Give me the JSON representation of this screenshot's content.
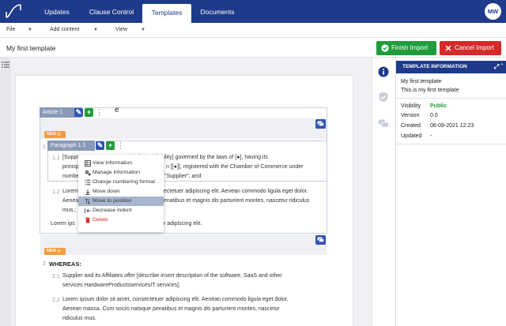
{
  "nav": {
    "tabs": [
      {
        "label": "Updates"
      },
      {
        "label": "Clause Control"
      },
      {
        "label": "Templates",
        "active": true
      },
      {
        "label": "Documents"
      }
    ],
    "avatar": "MW",
    "color": "#1e3a8a"
  },
  "menubar": {
    "file": "File",
    "add_content": "Add content",
    "view": "View"
  },
  "title": "My first template",
  "actions": {
    "finish": "Finish Import",
    "cancel": "Cancel Import",
    "finish_color": "#1f9d3a",
    "cancel_color": "#d42a2a"
  },
  "document": {
    "article_label": "Article 1",
    "article_title_tail": "e",
    "nda_tag": "NDA",
    "clause_num": "1",
    "paragraph_label": "Paragraph 1.1",
    "p11_num": "1.1",
    "p11_lines": [
      "[Suppl",
      "with limited liability] governed by the laws of [●], having its",
      "princip",
      "n [[●]], registered with the Chamber of Commerce under",
      "numbe",
      "\"Supplier\"; and"
    ],
    "p12_num": "1.2",
    "p12_lines": [
      "Lorem",
      "ectetuer adipiscing elit. Aenean commodo ligula eget dolor.",
      "Aenea",
      "enatibus et magnis dis parturient montes, nascetur ridiculus",
      "mus.;"
    ],
    "lorem_short_a": "Lorem ips",
    "lorem_short_b": "r adipiscing elit.",
    "whereas_num": "2",
    "whereas": "WHEREAS:",
    "p21_num": "2.1",
    "p21_lines": [
      "Supplier and its Affiliates offer [describe insert description of the software, SaaS and other",
      "services HardwareProductsservicesIT services]."
    ],
    "p22_num": "2.2",
    "p22_lines": [
      "Lorem ipsum dolor sit amet, consectetuer adipiscing elit. Aenean commodo ligula eget dolor.",
      "Aenean massa. Cum sociis natoque penatibus et magnis dis parturient montes, nascetur",
      "ridiculus mus."
    ]
  },
  "context_menu": {
    "items": [
      {
        "label": "View information",
        "icon": "table-icon"
      },
      {
        "label": "Manage information",
        "icon": "cogs-icon"
      },
      {
        "label": "Change numbering format",
        "icon": "list-icon"
      },
      {
        "label": "Move down",
        "icon": "arrow-down-icon"
      },
      {
        "label": "Move to position",
        "icon": "sort-icon",
        "highlighted": true
      },
      {
        "label": "Decrease indent",
        "icon": "outdent-icon"
      },
      {
        "label": "Delete",
        "icon": "trash-icon",
        "danger": true
      }
    ]
  },
  "panel": {
    "header": "TEMPLATE INFORMATION",
    "name": "My first template",
    "description": "This is my first template",
    "fields": [
      {
        "label": "Visibility",
        "value": "Public"
      },
      {
        "label": "Version",
        "value": "0.0"
      },
      {
        "label": "Created",
        "value": "06-09-2021 12:23"
      },
      {
        "label": "Updated",
        "value": "-"
      }
    ]
  }
}
